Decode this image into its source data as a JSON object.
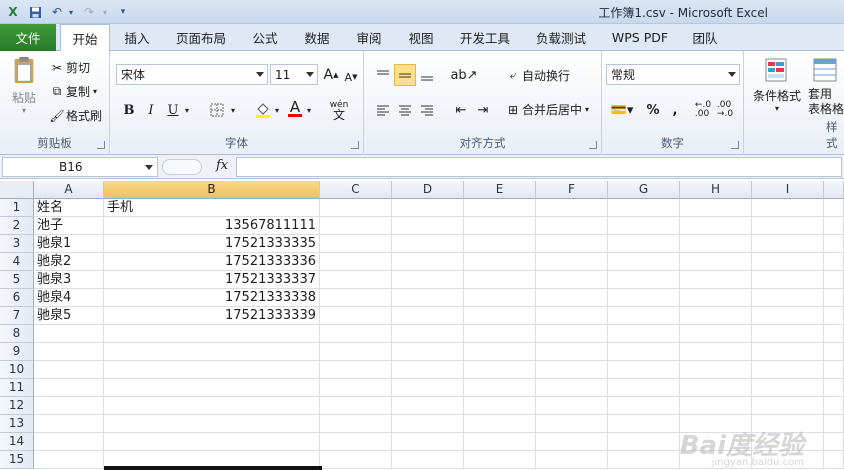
{
  "window": {
    "title": "工作簿1.csv  -  Microsoft Excel"
  },
  "quick_access": {
    "app_icon": "excel-icon",
    "save": "save-icon",
    "undo": "undo-icon",
    "redo": "redo-icon",
    "customize": "customize-icon"
  },
  "tabs": {
    "file": "文件",
    "items": [
      "开始",
      "插入",
      "页面布局",
      "公式",
      "数据",
      "审阅",
      "视图",
      "开发工具",
      "负载测试",
      "WPS PDF",
      "团队"
    ],
    "active": "开始"
  },
  "ribbon": {
    "clipboard": {
      "label": "剪贴板",
      "paste": "粘贴",
      "cut": "剪切",
      "copy": "复制",
      "format_painter": "格式刷"
    },
    "font": {
      "label": "字体",
      "font_name": "宋体",
      "font_size": "11",
      "bold": "B",
      "italic": "I",
      "underline": "U",
      "grow": "A",
      "shrink": "A",
      "wen": "wén"
    },
    "alignment": {
      "label": "对齐方式",
      "wrap_text": "自动换行",
      "merge_center": "合并后居中"
    },
    "number": {
      "label": "数字",
      "format": "常规",
      "percent": "%",
      "comma": ",",
      "inc_decimal": "←.0\n.00",
      "dec_decimal": ".00\n→.0"
    },
    "styles": {
      "conditional": "条件格式",
      "table_format": "套用\n表格格式",
      "partial": "样式"
    }
  },
  "formula_bar": {
    "name_box": "B16",
    "fx": "fx",
    "content": ""
  },
  "sheet": {
    "columns": [
      "A",
      "B",
      "C",
      "D",
      "E",
      "F",
      "G",
      "H",
      "I"
    ],
    "selected_column": "B",
    "rows": [
      "1",
      "2",
      "3",
      "4",
      "5",
      "6",
      "7",
      "8",
      "9",
      "10",
      "11",
      "12",
      "13",
      "14",
      "15"
    ],
    "cells": [
      [
        "姓名",
        "手机"
      ],
      [
        "池子",
        "13567811111"
      ],
      [
        "驰泉1",
        "17521333335"
      ],
      [
        "驰泉2",
        "17521333336"
      ],
      [
        "驰泉3",
        "17521333337"
      ],
      [
        "驰泉4",
        "17521333338"
      ],
      [
        "驰泉5",
        "17521333339"
      ]
    ]
  },
  "watermark": {
    "text": "Bai度经验",
    "sub": "jingyan.baidu.com"
  },
  "colors": {
    "file_tab": "#2a7a27",
    "selected_header": "#f1c15f",
    "ribbon_bg": "#e9eff7"
  }
}
